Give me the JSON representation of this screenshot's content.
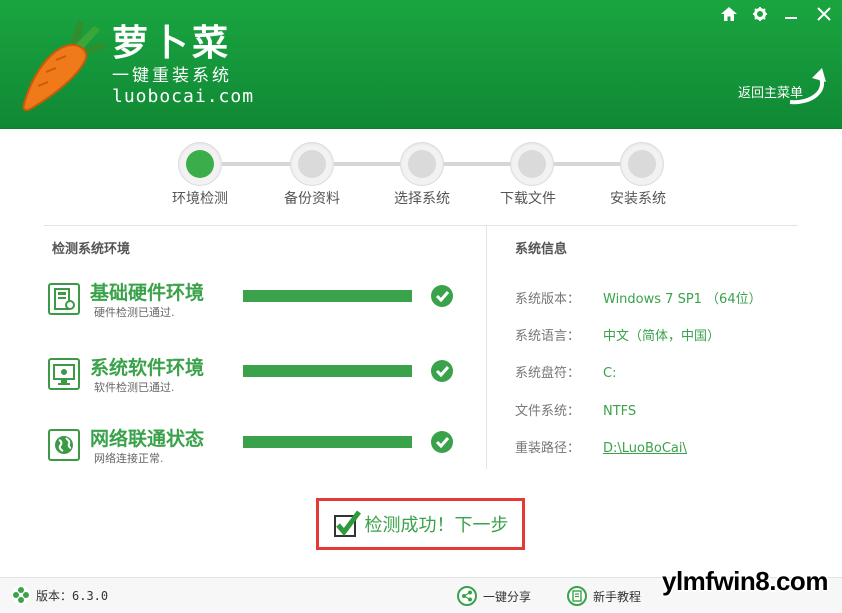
{
  "app": {
    "title": "萝卜菜",
    "subtitle": "一键重装系统",
    "domain": "luobocai.com",
    "brand_color": "#14943a",
    "accent_color": "#3aa24a"
  },
  "window_controls": {
    "home_icon": "home-icon",
    "settings_icon": "gear-icon",
    "minimize_icon": "minimize-icon",
    "close_icon": "close-icon"
  },
  "header": {
    "back_label": "返回主菜单"
  },
  "steps": [
    {
      "label": "环境检测",
      "active": true
    },
    {
      "label": "备份资料",
      "active": false
    },
    {
      "label": "选择系统",
      "active": false
    },
    {
      "label": "下载文件",
      "active": false
    },
    {
      "label": "安装系统",
      "active": false
    }
  ],
  "detect": {
    "title": "检测系统环境",
    "items": [
      {
        "title": "基础硬件环境",
        "desc": "硬件检测已通过.",
        "icon": "hardware-icon",
        "progress": 1.0,
        "status": "passed"
      },
      {
        "title": "系统软件环境",
        "desc": "软件检测已通过.",
        "icon": "monitor-icon",
        "progress": 1.0,
        "status": "passed"
      },
      {
        "title": "网络联通状态",
        "desc": "网络连接正常.",
        "icon": "globe-icon",
        "progress": 1.0,
        "status": "passed"
      }
    ]
  },
  "sysinfo": {
    "title": "系统信息",
    "rows": [
      {
        "key": "系统版本：",
        "value": "Windows 7 SP1 （64位）"
      },
      {
        "key": "系统语言：",
        "value": "中文（简体，中国）"
      },
      {
        "key": "系统盘符：",
        "value": "C:"
      },
      {
        "key": "文件系统：",
        "value": "NTFS"
      },
      {
        "key": "重装路径：",
        "value": "D:\\LuoBoCai\\"
      }
    ]
  },
  "next_button": {
    "label": "检测成功！下一步"
  },
  "footer": {
    "version_label": "版本：6.3.0",
    "share_label": "一键分享",
    "tutorial_label": "新手教程",
    "watermark": "ylmfwin8.com"
  }
}
